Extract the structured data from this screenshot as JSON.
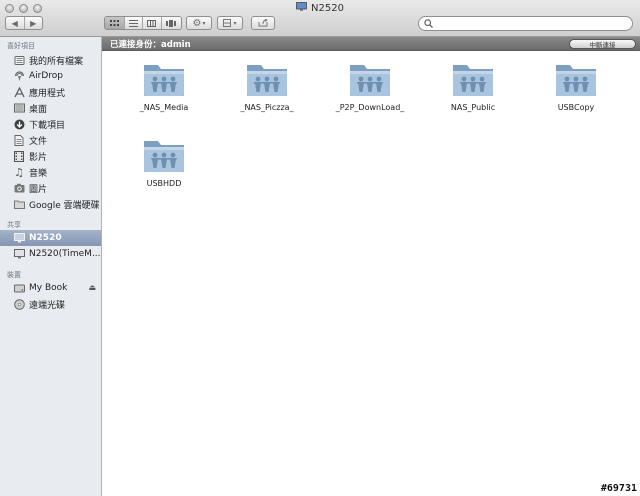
{
  "window": {
    "title": "N2520"
  },
  "search": {
    "placeholder": "",
    "value": ""
  },
  "sidebar": {
    "favorites_title": "喜好項目",
    "favorites": [
      {
        "label": "我的所有檔案",
        "icon": "all-files-icon"
      },
      {
        "label": "AirDrop",
        "icon": "airdrop-icon"
      },
      {
        "label": "應用程式",
        "icon": "applications-icon"
      },
      {
        "label": "桌面",
        "icon": "desktop-icon"
      },
      {
        "label": "下載項目",
        "icon": "downloads-icon"
      },
      {
        "label": "文件",
        "icon": "documents-icon"
      },
      {
        "label": "影片",
        "icon": "movies-icon"
      },
      {
        "label": "音樂",
        "icon": "music-icon"
      },
      {
        "label": "圖片",
        "icon": "pictures-icon"
      },
      {
        "label": "Google 雲端硬碟",
        "icon": "folder-icon"
      }
    ],
    "shared_title": "共享",
    "shared": [
      {
        "label": "N2520",
        "icon": "monitor-icon",
        "selected": true
      },
      {
        "label": "N2520(TimeM...",
        "icon": "monitor-icon",
        "selected": false
      }
    ],
    "devices_title": "裝置",
    "devices": [
      {
        "label": "My Book",
        "icon": "drive-icon",
        "eject": true
      },
      {
        "label": "遠端光碟",
        "icon": "disc-icon",
        "eject": false
      }
    ]
  },
  "connection": {
    "status_text": "已連接身份：admin",
    "disconnect_label": "中斷連接"
  },
  "folders": [
    {
      "name": "_NAS_Media"
    },
    {
      "name": "_NAS_Piczza_"
    },
    {
      "name": "_P2P_DownLoad_"
    },
    {
      "name": "NAS_Public"
    },
    {
      "name": "USBCopy"
    },
    {
      "name": "USBHDD"
    }
  ],
  "watermark": "#69731",
  "colors": {
    "selection": "#8fa0bb",
    "sidebar_bg": "#e8ecf1",
    "folder": "#8fb1d0"
  }
}
